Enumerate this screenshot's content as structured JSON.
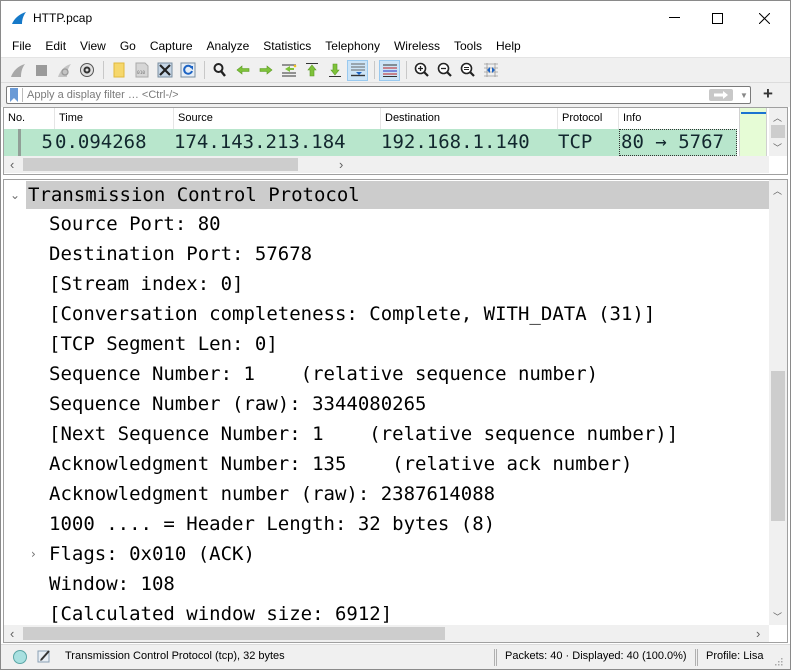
{
  "window": {
    "title": "HTTP.pcap",
    "controls": {
      "minimize": "—",
      "maximize": "☐",
      "close": "✕"
    }
  },
  "menu": {
    "items": [
      "File",
      "Edit",
      "View",
      "Go",
      "Capture",
      "Analyze",
      "Statistics",
      "Telephony",
      "Wireless",
      "Tools",
      "Help"
    ]
  },
  "toolbar": {
    "buttons": [
      "start-capture",
      "stop-capture",
      "restart-capture",
      "capture-options",
      "open-file",
      "save-file",
      "close-file",
      "reload-file",
      "find-packet",
      "go-back",
      "go-forward",
      "go-to-packet",
      "go-first",
      "go-last",
      "auto-scroll",
      "colorize",
      "zoom-in",
      "zoom-out",
      "normal-size",
      "resize-columns"
    ],
    "active": [
      "auto-scroll",
      "colorize"
    ]
  },
  "filter": {
    "placeholder": "Apply a display filter … <Ctrl-/>",
    "value": "",
    "add_label": "+"
  },
  "packet_list": {
    "columns": [
      "No.",
      "Time",
      "Source",
      "Destination",
      "Protocol",
      "Info"
    ],
    "rows": [
      {
        "no": "5",
        "time": "0.094268",
        "source": "174.143.213.184",
        "destination": "192.168.1.140",
        "protocol": "TCP",
        "info": "80 → 5767"
      }
    ],
    "row_color": "#b8e6cc"
  },
  "details": {
    "root": {
      "label": "Transmission Control Protocol",
      "expanded": true
    },
    "fields": [
      {
        "label": "Source Port: 80"
      },
      {
        "label": "Destination Port: 57678"
      },
      {
        "label": "[Stream index: 0]"
      },
      {
        "label": "[Conversation completeness: Complete, WITH_DATA (31)]"
      },
      {
        "label": "[TCP Segment Len: 0]"
      },
      {
        "label": "Sequence Number: 1    (relative sequence number)"
      },
      {
        "label": "Sequence Number (raw): 3344080265"
      },
      {
        "label": "[Next Sequence Number: 1    (relative sequence number)]"
      },
      {
        "label": "Acknowledgment Number: 135    (relative ack number)"
      },
      {
        "label": "Acknowledgment number (raw): 2387614088"
      },
      {
        "label": "1000 .... = Header Length: 32 bytes (8)"
      },
      {
        "label": "Flags: 0x010 (ACK)",
        "expandable": true
      },
      {
        "label": "Window: 108"
      },
      {
        "label": "[Calculated window size: 6912]"
      }
    ]
  },
  "status": {
    "field_info": "Transmission Control Protocol (tcp), 32 bytes",
    "packets": "Packets: 40 · Displayed: 40 (100.0%)",
    "profile": "Profile: Lisa"
  },
  "colors": {
    "row_tcp": "#b8e6cc",
    "selected_tree": "#cccccc",
    "accent": "#1a73d1"
  }
}
